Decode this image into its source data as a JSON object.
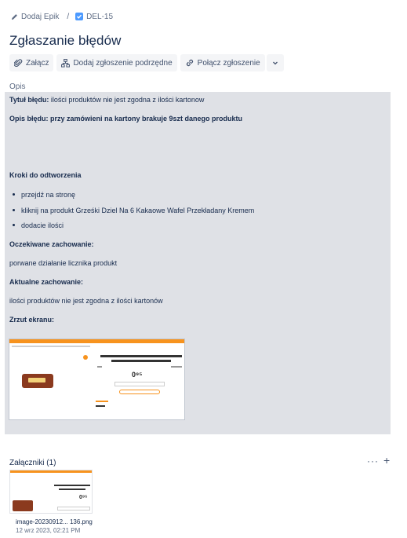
{
  "breadcrumb": {
    "add_epic": "Dodaj Epik",
    "separator": "/",
    "issue_key": "DEL-15"
  },
  "title": "Zgłaszanie błędów",
  "toolbar": {
    "attach": "Załącz",
    "add_child": "Dodaj zgłoszenie podrzędne",
    "link_issue": "Połącz zgłoszenie"
  },
  "description": {
    "label": "Opis",
    "bug_title_label": "Tytuł błędu:",
    "bug_title_text": " ilości  produktów nie jest  zgodna z ilości kartonow",
    "bug_desc": "Opis błędu:  przy zamówieni na kartony brakuje 9szt  danego produktu",
    "steps_header": "Kroki do odtworzenia",
    "steps": [
      "przejdź na stronę",
      "kliknij na produkt Grześki Dziel Na 6 Kakaowe Wafel Przekładany Kremem",
      "dodacie ilości"
    ],
    "expected_header": "Oczekiwane zachowanie:",
    "expected_text": "porwane działanie licznika produkt",
    "actual_header": "Aktualne zachowanie:",
    "actual_text": " ilości  produktów nie jest  zgodna z ilości kartonów",
    "screenshot_header": "Zrzut ekranu:",
    "screenshot_price": "0⁹⁵"
  },
  "attachments": {
    "title": "Załączniki (1)",
    "more": "···",
    "add": "+",
    "items": [
      {
        "price": "0⁹⁵",
        "name": "image-20230912... 136.png",
        "date": "12 wrz 2023, 02:21 PM"
      }
    ]
  },
  "colors": {
    "accent": "#4c9aff",
    "panel": "#dfe1e6",
    "brand_orange": "#f7931e"
  }
}
